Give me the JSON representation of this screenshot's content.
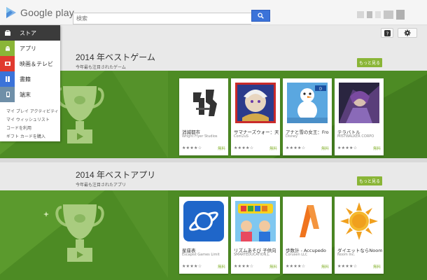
{
  "header": {
    "logo_text": "Google play",
    "search_placeholder": "検索"
  },
  "sidebar": {
    "items": [
      {
        "label": "ストア",
        "color": "#3b3b3b",
        "icon": "play-store-icon"
      },
      {
        "label": "アプリ",
        "color": "#8ab537",
        "icon": "android-icon"
      },
      {
        "label": "映画＆テレビ",
        "color": "#e03a2f",
        "icon": "film-icon"
      },
      {
        "label": "書籍",
        "color": "#3b73d9",
        "icon": "book-icon"
      },
      {
        "label": "端末",
        "color": "#6f8fa8",
        "icon": "device-icon"
      }
    ],
    "links": [
      "マイ プレイ アクティビティ",
      "マイ ウィッシュリスト",
      "コードを利用",
      "ギフト カードを購入"
    ]
  },
  "toolbar": {
    "help_icon": "help-icon",
    "settings_icon": "gear-icon"
  },
  "sections": [
    {
      "title": "2014 年ベストゲーム",
      "subtitle": "今年最も注目されたゲーム",
      "more_label": "もっと見る",
      "cards": [
        {
          "title": "消滅都市",
          "developer": "Wright Flyer Studios",
          "stars": "★★★★☆",
          "price": "無料",
          "art": "shoumetsu"
        },
        {
          "title": "サマナーズウォー：天",
          "developer": "Com2uS",
          "stars": "★★★★☆",
          "price": "無料",
          "art": "summoners"
        },
        {
          "title": "アナと雪の女王：Fro",
          "developer": "Disney",
          "stars": "★★★★☆",
          "price": "無料",
          "art": "frozen"
        },
        {
          "title": "テラバトル",
          "developer": "MISTWALKER CORPO",
          "stars": "★★★★☆",
          "price": "無料",
          "art": "terra"
        }
      ]
    },
    {
      "title": "2014 年ベストアプリ",
      "subtitle": "今年最も注目されたアプリ",
      "more_label": "もっと見る",
      "cards": [
        {
          "title": "星座表",
          "developer": "Escapist Games Limit",
          "stars": "★★★★☆",
          "price": "無料",
          "art": "star"
        },
        {
          "title": "リズムあそび 子供向",
          "developer": "SMARTEDUCATION,L",
          "stars": "★★★★☆",
          "price": "無料",
          "art": "kids"
        },
        {
          "title": "歩数計 - Accupedo",
          "developer": "Corusen LLC",
          "stars": "★★★★☆",
          "price": "無料",
          "art": "pedometer"
        },
        {
          "title": "ダイエットならNoom",
          "developer": "Noom Inc.",
          "stars": "★★★★☆",
          "price": "無料",
          "art": "noom"
        }
      ]
    }
  ]
}
